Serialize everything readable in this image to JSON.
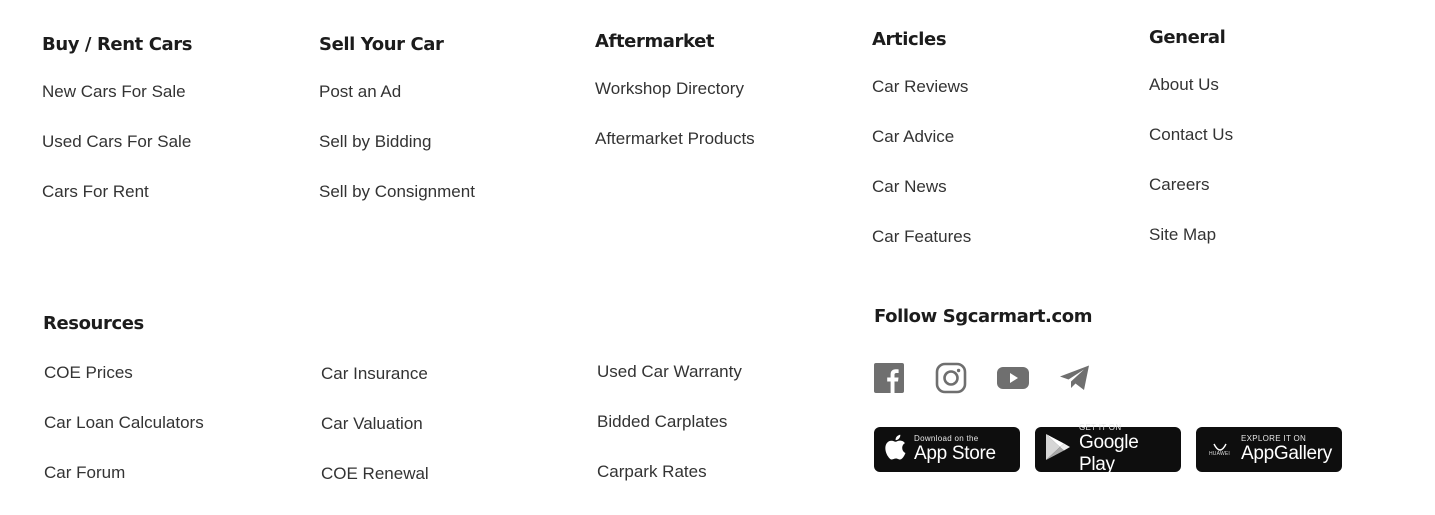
{
  "columns": {
    "buy": {
      "heading": "Buy / Rent Cars",
      "links": [
        "New Cars For Sale",
        "Used Cars For Sale",
        "Cars For Rent"
      ]
    },
    "sell": {
      "heading": "Sell Your Car",
      "links": [
        "Post an Ad",
        "Sell by Bidding",
        "Sell by Consignment"
      ]
    },
    "aftermarket": {
      "heading": "Aftermarket",
      "links": [
        "Workshop Directory",
        "Aftermarket Products"
      ]
    },
    "articles": {
      "heading": "Articles",
      "links": [
        "Car Reviews",
        "Car Advice",
        "Car News",
        "Car Features"
      ]
    },
    "general": {
      "heading": "General",
      "links": [
        "About Us",
        "Contact Us",
        "Careers",
        "Site Map"
      ]
    }
  },
  "resources": {
    "heading": "Resources",
    "col1": [
      "COE Prices",
      "Car Loan Calculators",
      "Car Forum"
    ],
    "col2": [
      "Car Insurance",
      "Car Valuation",
      "COE Renewal"
    ],
    "col3": [
      "Used Car Warranty",
      "Bidded Carplates",
      "Carpark Rates"
    ]
  },
  "follow": {
    "heading": "Follow Sgcarmart.com",
    "social_icons": [
      "facebook-icon",
      "instagram-icon",
      "youtube-icon",
      "telegram-icon"
    ],
    "icon_color": "#6f6f6f"
  },
  "stores": {
    "appstore": {
      "small": "Download on the",
      "big": "App Store"
    },
    "google": {
      "small": "GET IT ON",
      "big": "Google Play"
    },
    "huawei": {
      "small": "EXPLORE IT ON",
      "big": "AppGallery",
      "logo_text": "HUAWEI"
    }
  },
  "colors": {
    "text": "#333333",
    "heading": "#1c1c1c",
    "badge_bg": "#0e0e0e"
  }
}
